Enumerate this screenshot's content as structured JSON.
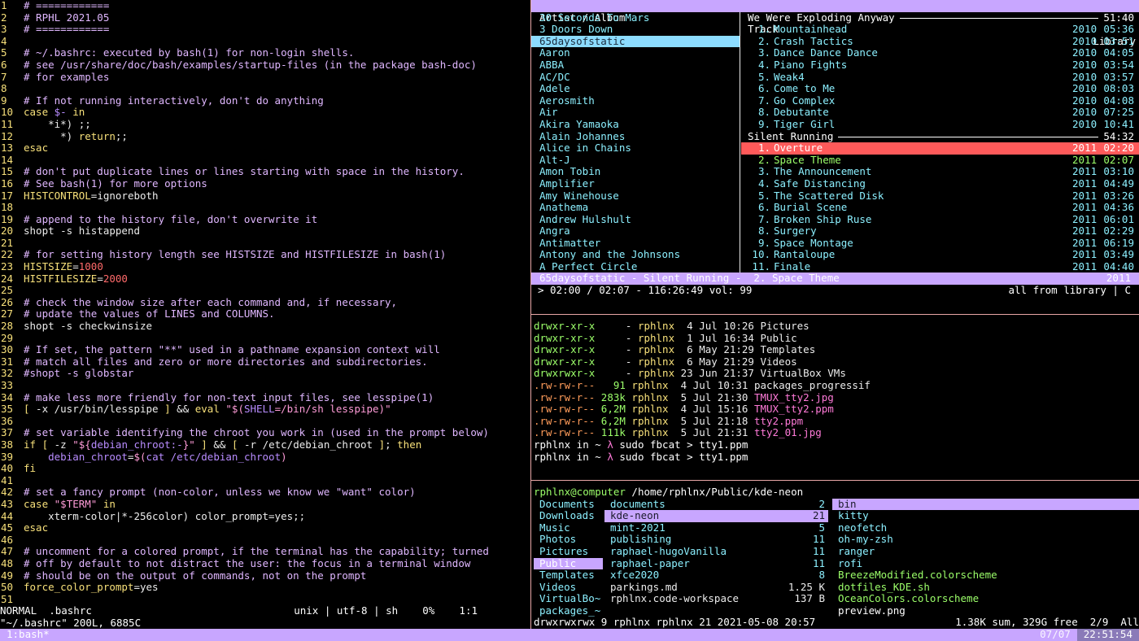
{
  "vim": {
    "lines": [
      [
        [
          "c-comment",
          "# ============"
        ]
      ],
      [
        [
          "c-comment",
          "# RPHL 2021.05"
        ]
      ],
      [
        [
          "c-comment",
          "# ============"
        ]
      ],
      [],
      [
        [
          "c-comment",
          "# ~/.bashrc: executed by bash(1) for non-login shells."
        ]
      ],
      [
        [
          "c-comment",
          "# see /usr/share/doc/bash/examples/startup-files (in the package bash-doc)"
        ]
      ],
      [
        [
          "c-comment",
          "# for examples"
        ]
      ],
      [],
      [
        [
          "c-comment",
          "# If not running interactively, don't do anything"
        ]
      ],
      [
        [
          "c-kw",
          "case"
        ],
        [
          "c-norm",
          " "
        ],
        [
          "c-var",
          "$-"
        ],
        [
          "c-norm",
          " "
        ],
        [
          "c-kw",
          "in"
        ]
      ],
      [
        [
          "c-norm",
          "    *i*) ;;"
        ]
      ],
      [
        [
          "c-norm",
          "      *) "
        ],
        [
          "c-kw",
          "return"
        ],
        [
          "c-norm",
          ";;"
        ]
      ],
      [
        [
          "c-kw",
          "esac"
        ]
      ],
      [],
      [
        [
          "c-comment",
          "# don't put duplicate lines or lines starting with space in the history."
        ]
      ],
      [
        [
          "c-comment",
          "# See bash(1) for more options"
        ]
      ],
      [
        [
          "c-kw",
          "HISTCONTROL"
        ],
        [
          "c-norm",
          "=ignoreboth"
        ]
      ],
      [],
      [
        [
          "c-comment",
          "# append to the history file, don't overwrite it"
        ]
      ],
      [
        [
          "c-norm",
          "shopt -s histappend"
        ]
      ],
      [],
      [
        [
          "c-comment",
          "# for setting history length see HISTSIZE and HISTFILESIZE in bash(1)"
        ]
      ],
      [
        [
          "c-kw",
          "HISTSIZE"
        ],
        [
          "c-norm",
          "="
        ],
        [
          "c-num",
          "1000"
        ]
      ],
      [
        [
          "c-kw",
          "HISTFILESIZE"
        ],
        [
          "c-norm",
          "="
        ],
        [
          "c-num",
          "2000"
        ]
      ],
      [],
      [
        [
          "c-comment",
          "# check the window size after each command and, if necessary,"
        ]
      ],
      [
        [
          "c-comment",
          "# update the values of LINES and COLUMNS."
        ]
      ],
      [
        [
          "c-norm",
          "shopt -s checkwinsize"
        ]
      ],
      [],
      [
        [
          "c-comment",
          "# If set, the pattern \"**\" used in a pathname expansion context will"
        ]
      ],
      [
        [
          "c-comment",
          "# match all files and zero or more directories and subdirectories."
        ]
      ],
      [
        [
          "c-comment",
          "#shopt -s globstar"
        ]
      ],
      [],
      [
        [
          "c-comment",
          "# make less more friendly for non-text input files, see lesspipe(1)"
        ]
      ],
      [
        [
          "c-kw",
          "["
        ],
        [
          "c-norm",
          " -x /usr/bin/lesspipe "
        ],
        [
          "c-kw",
          "]"
        ],
        [
          "c-norm",
          " && "
        ],
        [
          "c-kw",
          "eval"
        ],
        [
          "c-norm",
          " "
        ],
        [
          "c-str",
          "\"$("
        ],
        [
          "c-var",
          "SHELL"
        ],
        [
          "c-str",
          "=/bin/sh lesspipe)\""
        ]
      ],
      [],
      [
        [
          "c-comment",
          "# set variable identifying the chroot you work in (used in the prompt below)"
        ]
      ],
      [
        [
          "c-kw",
          "if"
        ],
        [
          "c-norm",
          " "
        ],
        [
          "c-kw",
          "["
        ],
        [
          "c-norm",
          " -z "
        ],
        [
          "c-str",
          "\"${"
        ],
        [
          "c-var",
          "debian_chroot:-"
        ],
        [
          "c-str",
          "}\""
        ],
        [
          "c-norm",
          " "
        ],
        [
          "c-kw",
          "]"
        ],
        [
          "c-norm",
          " && "
        ],
        [
          "c-kw",
          "["
        ],
        [
          "c-norm",
          " -r /etc/debian_chroot "
        ],
        [
          "c-kw",
          "]"
        ],
        [
          "c-norm",
          "; "
        ],
        [
          "c-kw",
          "then"
        ]
      ],
      [
        [
          "c-norm",
          "    "
        ],
        [
          "c-var",
          "debian_chroot"
        ],
        [
          "c-norm",
          "="
        ],
        [
          "c-str",
          "$("
        ],
        [
          "c-var",
          "cat /etc/debian_chroot"
        ],
        [
          "c-str",
          ")"
        ]
      ],
      [
        [
          "c-kw",
          "fi"
        ]
      ],
      [],
      [
        [
          "c-comment",
          "# set a fancy prompt (non-color, unless we know we \"want\" color)"
        ]
      ],
      [
        [
          "c-kw",
          "case"
        ],
        [
          "c-norm",
          " "
        ],
        [
          "c-str",
          "\"$TERM\""
        ],
        [
          "c-norm",
          " "
        ],
        [
          "c-kw",
          "in"
        ]
      ],
      [
        [
          "c-norm",
          "    xterm-color|*-256color) color_prompt=yes;;"
        ]
      ],
      [
        [
          "c-kw",
          "esac"
        ]
      ],
      [],
      [
        [
          "c-comment",
          "# uncomment for a colored prompt, if the terminal has the capability; turned"
        ]
      ],
      [
        [
          "c-comment",
          "# off by default to not distract the user: the focus in a terminal window"
        ]
      ],
      [
        [
          "c-comment",
          "# should be on the output of commands, not on the prompt"
        ]
      ],
      [
        [
          "c-kw",
          "force_color_prompt"
        ],
        [
          "c-norm",
          "=yes"
        ]
      ],
      []
    ],
    "status": "NORMAL  .bashrc                                 unix | utf-8 | sh    0%    1:1",
    "message": "\"~/.bashrc\" 200L, 6885C"
  },
  "cmus": {
    "header_left": "Artist / Album",
    "header_mid": "Track",
    "header_right": "Library",
    "artists": [
      "30 Seconds To Mars",
      "3 Doors Down",
      "65daysofstatic",
      "Aaron",
      "ABBA",
      "AC/DC",
      "Adele",
      "Aerosmith",
      "Air",
      "Akira Yamaoka",
      "Alain Johannes",
      "Alice in Chains",
      "Alt-J",
      "Amon Tobin",
      "Amplifier",
      "Amy Winehouse",
      "Anathema",
      "Andrew Hulshult",
      "Angra",
      "Antimatter",
      "Antony and the Johnsons",
      "A Perfect Circle"
    ],
    "selected_artist": 2,
    "albums": [
      {
        "name": "We Were Exploding Anyway",
        "duration": "51:40",
        "tracks": [
          {
            "n": "1.",
            "t": "Mountainhead",
            "y": "2010",
            "d": "05:36"
          },
          {
            "n": "2.",
            "t": "Crash Tactics",
            "y": "2010",
            "d": "03:51"
          },
          {
            "n": "3.",
            "t": "Dance Dance Dance",
            "y": "2010",
            "d": "04:05"
          },
          {
            "n": "4.",
            "t": "Piano Fights",
            "y": "2010",
            "d": "03:54"
          },
          {
            "n": "5.",
            "t": "Weak4",
            "y": "2010",
            "d": "03:57"
          },
          {
            "n": "6.",
            "t": "Come to Me",
            "y": "2010",
            "d": "08:03"
          },
          {
            "n": "7.",
            "t": "Go Complex",
            "y": "2010",
            "d": "04:08"
          },
          {
            "n": "8.",
            "t": "Debutante",
            "y": "2010",
            "d": "07:25"
          },
          {
            "n": "9.",
            "t": "Tiger Girl",
            "y": "2010",
            "d": "10:41"
          }
        ]
      },
      {
        "name": "Silent Running",
        "duration": "54:32",
        "tracks": [
          {
            "n": "1.",
            "t": "Overture",
            "y": "2011",
            "d": "02:20",
            "cur": true
          },
          {
            "n": "2.",
            "t": "Space Theme",
            "y": "2011",
            "d": "02:07",
            "play": true
          },
          {
            "n": "3.",
            "t": "The Announcement",
            "y": "2011",
            "d": "03:10"
          },
          {
            "n": "4.",
            "t": "Safe Distancing",
            "y": "2011",
            "d": "04:49"
          },
          {
            "n": "5.",
            "t": "The Scattered Disk",
            "y": "2011",
            "d": "03:26"
          },
          {
            "n": "6.",
            "t": "Burial Scene",
            "y": "2011",
            "d": "04:36"
          },
          {
            "n": "7.",
            "t": "Broken Ship Ruse",
            "y": "2011",
            "d": "06:01"
          },
          {
            "n": "8.",
            "t": "Surgery",
            "y": "2011",
            "d": "02:29"
          },
          {
            "n": "9.",
            "t": "Space Montage",
            "y": "2011",
            "d": "06:19"
          },
          {
            "n": "10.",
            "t": "Rantaloupe",
            "y": "2011",
            "d": "03:49"
          },
          {
            "n": "11.",
            "t": "Finale",
            "y": "2011",
            "d": "04:40"
          }
        ]
      }
    ],
    "now_playing": "65daysofstatic - Silent Running -  2. Space Theme",
    "now_playing_year": "2011",
    "status_left": "> 02:00 / 02:07 - 116:26:49 vol: 99",
    "status_right": "all from library | C"
  },
  "ls": {
    "rows": [
      {
        "perm": "drwxr-xr-x",
        "type": "d",
        "size": "-",
        "user": "rphlnx",
        "date": " 4 Jul 10:26",
        "name": "Pictures",
        "kind": "dir"
      },
      {
        "perm": "drwxr-xr-x",
        "type": "d",
        "size": "-",
        "user": "rphlnx",
        "date": " 1 Jul 16:34",
        "name": "Public",
        "kind": "dir"
      },
      {
        "perm": "drwxr-xr-x",
        "type": "d",
        "size": "-",
        "user": "rphlnx",
        "date": " 6 May 21:29",
        "name": "Templates",
        "kind": "dir"
      },
      {
        "perm": "drwxr-xr-x",
        "type": "d",
        "size": "-",
        "user": "rphlnx",
        "date": " 6 May 21:29",
        "name": "Videos",
        "kind": "dir"
      },
      {
        "perm": "drwxrwxr-x",
        "type": "d",
        "size": "-",
        "user": "rphlnx",
        "date": "23 Jun 21:37",
        "name": "VirtualBox VMs",
        "kind": "dir"
      },
      {
        "perm": ".rw-rw-r--",
        "type": "f",
        "size": "91",
        "user": "rphlnx",
        "date": " 4 Jul 10:31",
        "name": "packages_progressif",
        "kind": "file"
      },
      {
        "perm": ".rw-rw-r--",
        "type": "f",
        "size": "283k",
        "user": "rphlnx",
        "date": " 5 Jul 21:30",
        "name": "TMUX_tty2.jpg",
        "kind": "img"
      },
      {
        "perm": ".rw-rw-r--",
        "type": "f",
        "size": "6,2M",
        "user": "rphlnx",
        "date": " 4 Jul 15:16",
        "name": "TMUX_tty2.ppm",
        "kind": "img"
      },
      {
        "perm": ".rw-rw-r--",
        "type": "f",
        "size": "6,2M",
        "user": "rphlnx",
        "date": " 5 Jul 21:18",
        "name": "tty2.ppm",
        "kind": "img"
      },
      {
        "perm": ".rw-rw-r--",
        "type": "f",
        "size": "111k",
        "user": "rphlnx",
        "date": " 5 Jul 21:31",
        "name": "tty2_01.jpg",
        "kind": "img"
      }
    ],
    "prompt_user": "rphlnx",
    "prompt_in": " in ~ ",
    "prompt_lambda": "λ",
    "command": " sudo fbcat > tty1.ppm"
  },
  "ranger": {
    "host": "rphlnx@computer",
    "path": " /home/rphlnx/Public/kde-neon",
    "col1": [
      "Documents",
      "Downloads",
      "Music",
      "Photos",
      "Pictures",
      "Public",
      "Templates",
      "Videos",
      "VirtualBo~",
      "packages_~"
    ],
    "col1_selected": 5,
    "col2": [
      {
        "n": "documents",
        "c": "2"
      },
      {
        "n": "kde-neon",
        "c": "21"
      },
      {
        "n": "mint-2021",
        "c": "5"
      },
      {
        "n": "publishing",
        "c": "11"
      },
      {
        "n": "raphael-hugoVanilla",
        "c": "11"
      },
      {
        "n": "raphael-paper",
        "c": "11"
      },
      {
        "n": "xfce2020",
        "c": "8"
      },
      {
        "n": "parkings.md",
        "c": "1.25 K"
      },
      {
        "n": "rphlnx.code-workspace",
        "c": "137 B"
      }
    ],
    "col2_selected": 1,
    "col3": [
      "bin",
      "kitty",
      "neofetch",
      "oh-my-zsh",
      "ranger",
      "rofi",
      "BreezeModified.colorscheme",
      "dotfiles_KDE.sh",
      "OceanColors.colorscheme",
      "preview.png"
    ],
    "footer_left": "drwxrwxrwx 9 rphlnx rphlnx 21 2021-05-08 20:57",
    "footer_right": "1.38K sum, 329G free  2/9  All"
  },
  "tmux": {
    "window": "1:bash*",
    "date": "07/07",
    "time": "22:51:54"
  }
}
